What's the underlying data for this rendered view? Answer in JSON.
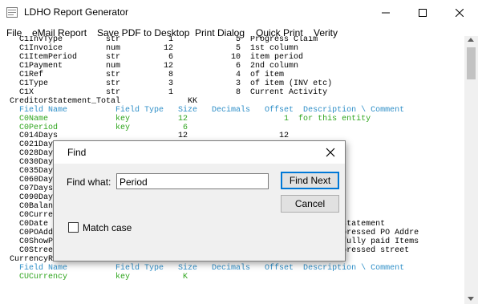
{
  "window": {
    "title": "LDHO Report Generator",
    "icons": {
      "app": "report-app-icon",
      "minimize": "minimize-icon",
      "maximize": "maximize-icon",
      "close": "close-icon"
    }
  },
  "menu": {
    "items": [
      "File",
      "eMail Report",
      "Save PDF to Desktop",
      "Print Dialog",
      "Quick Print",
      "Verity"
    ]
  },
  "colors": {
    "field_header": "#2f8fc8",
    "key_field": "#2fa51e",
    "text": "#000000"
  },
  "report_lines": [
    {
      "text": "    C1InvType         str          1             5  Progress Claim",
      "color": "text"
    },
    {
      "text": "    C1Invoice         num         12             5  1st column",
      "color": "text"
    },
    {
      "text": "    C1ItemPeriod      str          6            10  item period",
      "color": "text"
    },
    {
      "text": "    C1Payment         num         12             6  2nd column",
      "color": "text"
    },
    {
      "text": "    C1Ref             str          8             4  of item",
      "color": "text"
    },
    {
      "text": "    C1Type            str          3             3  of item (INV etc)",
      "color": "text"
    },
    {
      "text": "    C1X               str          1             8  Current Activity",
      "color": "text"
    },
    {
      "text": "  CreditorStatement_Total              KK",
      "color": "text"
    },
    {
      "text": "    Field Name          Field Type   Size   Decimals   Offset  Description \\ Comment",
      "color": "field_header"
    },
    {
      "text": "    C0Name              key          12                    1  for this entity",
      "color": "key_field"
    },
    {
      "text": "    C0Period            key           6",
      "color": "key_field"
    },
    {
      "text": "    C014Days                         12                   12",
      "color": "text"
    },
    {
      "text": "    C021Days",
      "color": "text"
    },
    {
      "text": "    C028Days",
      "color": "text"
    },
    {
      "text": "    C030Days",
      "color": "text"
    },
    {
      "text": "    C035Days",
      "color": "text"
    },
    {
      "text": "    C060Days",
      "color": "text"
    },
    {
      "text": "    C07Days",
      "color": "text"
    },
    {
      "text": "    C090Days",
      "color": "text"
    },
    {
      "text": "    C0Balance                                                 t he owes",
      "color": "text"
    },
    {
      "text": "    C0Currency                                                ng",
      "color": "text"
    },
    {
      "text": "    C0Date                                                    print on statement",
      "color": "text"
    },
    {
      "text": "    C0POAddr                                                  blank suppressed PO Addre",
      "color": "text"
    },
    {
      "text": "    C0ShowPaid                                                c to see fully paid Items",
      "color": "text"
    },
    {
      "text": "    C0Street                                                  blank suppressed street",
      "color": "text"
    },
    {
      "text": "  CurrencyRate                         47",
      "color": "text"
    },
    {
      "text": "    Field Name          Field Type   Size   Decimals   Offset  Description \\ Comment",
      "color": "field_header"
    },
    {
      "text": "    CUCurrency          key           K",
      "color": "key_field"
    }
  ],
  "find_dialog": {
    "title": "Find",
    "find_what_label": "Find what:",
    "find_what_value": "Period",
    "find_next_label": "Find Next",
    "cancel_label": "Cancel",
    "match_case_label": "Match case",
    "match_case_checked": false
  }
}
